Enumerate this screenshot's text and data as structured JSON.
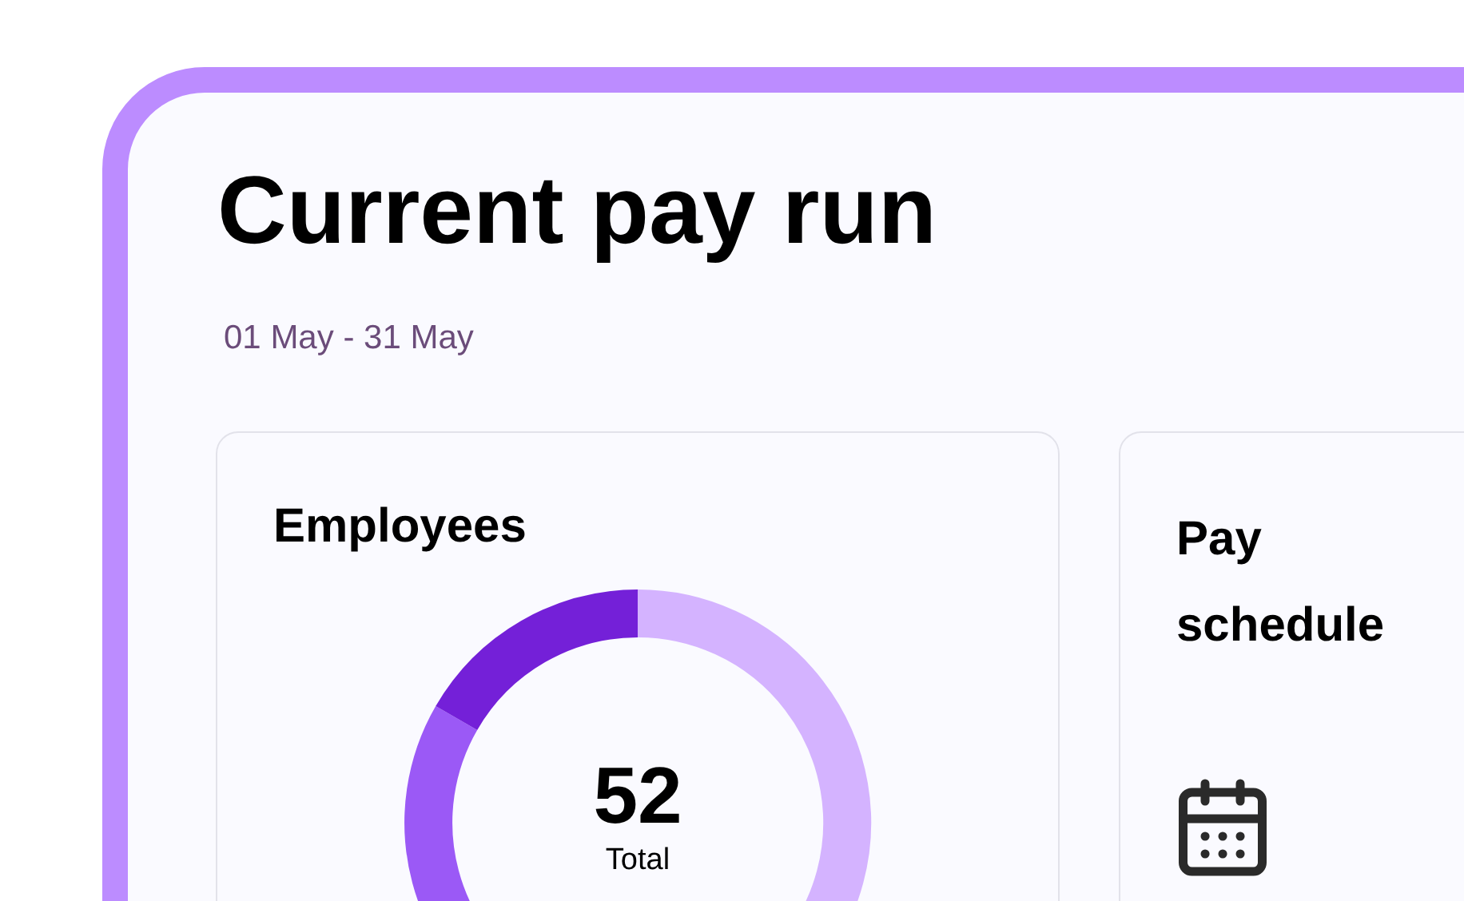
{
  "header": {
    "title": "Current pay run",
    "period": "01 May - 31 May"
  },
  "cards": [
    {
      "kind": "employees",
      "title": "Employees",
      "total": "52",
      "total_label": "Total"
    },
    {
      "kind": "schedule",
      "title": "Pay schedule"
    }
  ]
}
